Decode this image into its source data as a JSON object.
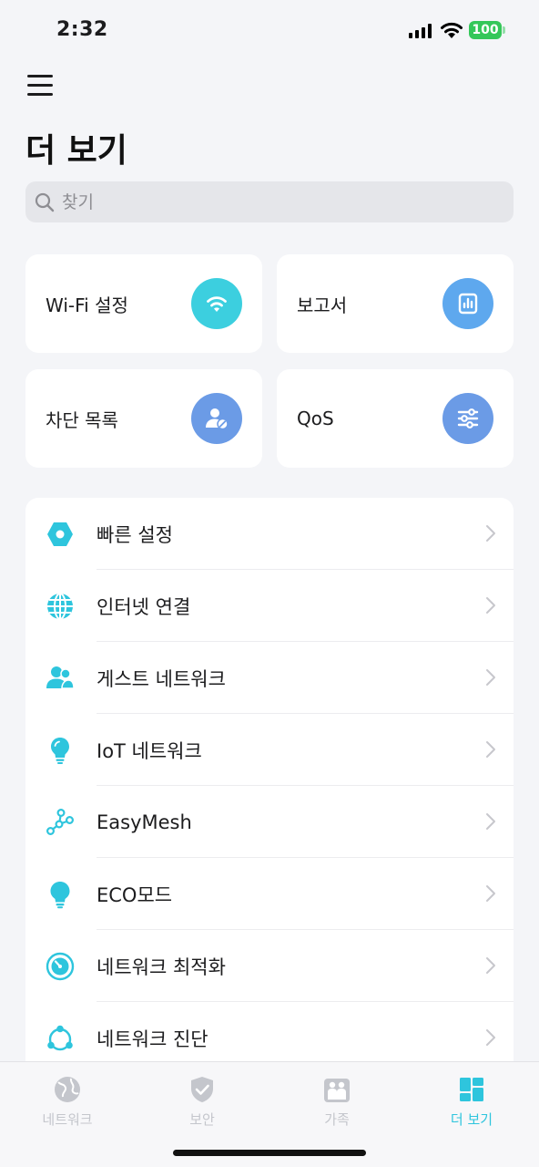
{
  "status_bar": {
    "time": "2:32",
    "battery": "100"
  },
  "header": {
    "title": "더 보기"
  },
  "search": {
    "placeholder": "찾기"
  },
  "tiles": [
    {
      "label": "Wi-Fi 설정",
      "icon": "wifi-icon",
      "color": "#3ccfdf"
    },
    {
      "label": "보고서",
      "icon": "report-chart-icon",
      "color": "#5ea8ee"
    },
    {
      "label": "차단 목록",
      "icon": "blocked-user-icon",
      "color": "#6b9be6"
    },
    {
      "label": "QoS",
      "icon": "sliders-icon",
      "color": "#6b9be6"
    }
  ],
  "list": [
    {
      "label": "빠른 설정",
      "icon": "hexagon-icon"
    },
    {
      "label": "인터넷 연결",
      "icon": "globe-icon"
    },
    {
      "label": "게스트 네트워크",
      "icon": "guests-icon"
    },
    {
      "label": "IoT 네트워크",
      "icon": "lightbulb-icon"
    },
    {
      "label": "EasyMesh",
      "icon": "mesh-nodes-icon"
    },
    {
      "label": "ECO모드",
      "icon": "eco-bulb-icon"
    },
    {
      "label": "네트워크 최적화",
      "icon": "optimize-gauge-icon"
    },
    {
      "label": "네트워크 진단",
      "icon": "diagnosis-icon"
    }
  ],
  "tab_bar": {
    "tabs": [
      {
        "label": "네트워크",
        "icon": "network-globe-icon",
        "active": false
      },
      {
        "label": "보안",
        "icon": "shield-check-icon",
        "active": false
      },
      {
        "label": "가족",
        "icon": "family-icon",
        "active": false
      },
      {
        "label": "더 보기",
        "icon": "more-grid-icon",
        "active": true
      }
    ]
  },
  "colors": {
    "accent": "#2ec5dd",
    "inactive": "#c4c6cc",
    "background": "#f4f5f8"
  }
}
